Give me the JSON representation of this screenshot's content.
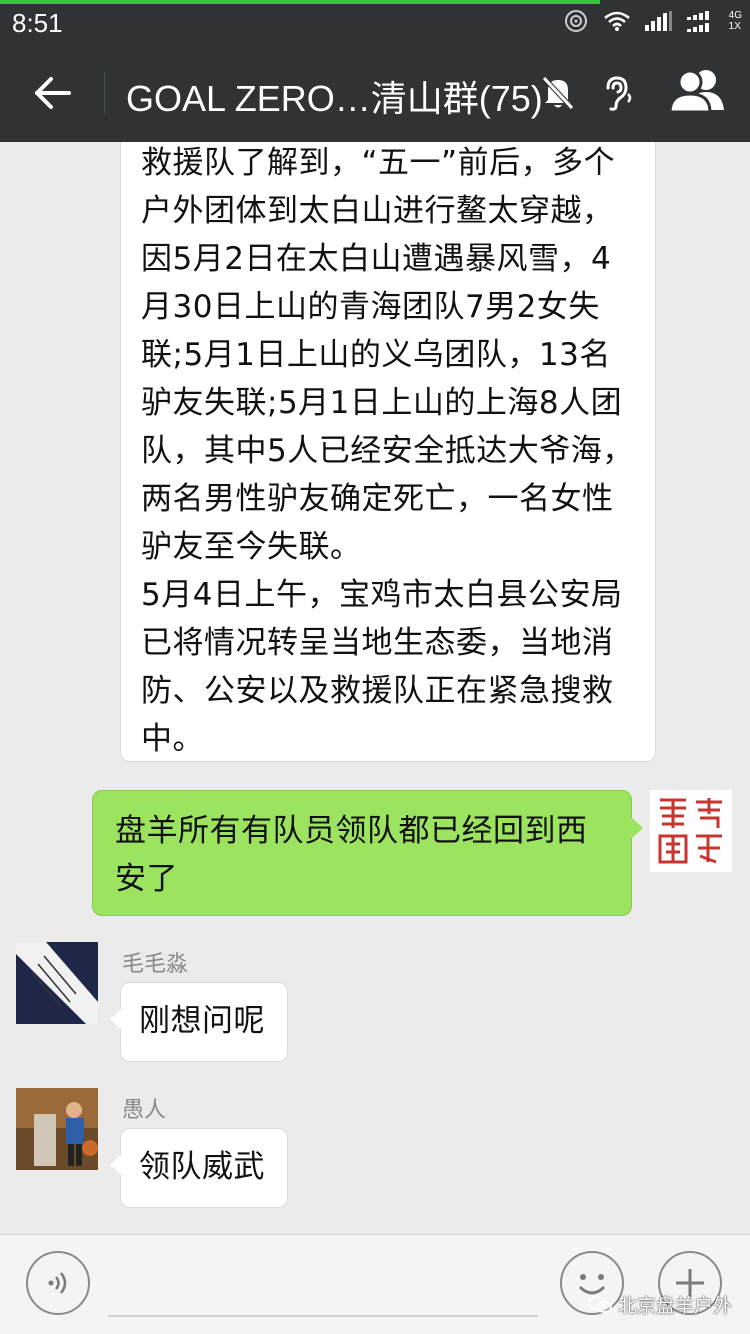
{
  "status_bar": {
    "time": "8:51",
    "network_top": "4G",
    "network_bottom": "1X"
  },
  "header": {
    "title": "GOAL ZERO…清山群(75)",
    "icons": [
      "back-arrow-icon",
      "mute-bell-icon",
      "earpiece-icon",
      "group-members-icon"
    ]
  },
  "messages": [
    {
      "side": "left",
      "lines": [
        "救援队了解到，“五一”前后，多个",
        "户外团体到太白山进行鳌太穿越，",
        "因5月2日在太白山遭遇暴风雪，4",
        "月30日上山的青海团队7男2女失",
        "联;5月1日上山的义乌团队，13名",
        "驴友失联;5月1日上山的上海8人团",
        "队，其中5人已经安全抵达大爷海，",
        "两名男性驴友确定死亡，一名女性",
        "驴友至今失联。",
        "5月4日上午，宝鸡市太白县公安局",
        "已将情况转呈当地生态委，当地消",
        "防、公安以及救援队正在紧急搜救",
        "中。"
      ]
    },
    {
      "side": "right",
      "text": "盘羊所有有队员领队都已经回到西安了"
    },
    {
      "side": "left",
      "sender": "毛毛淼",
      "text": "刚想问呢"
    },
    {
      "side": "left",
      "sender": "愚人",
      "text": "领队威武"
    }
  ],
  "input_bar": {
    "watermark": "北京盘羊户外"
  },
  "colors": {
    "header_bg": "#2f3336",
    "chat_bg": "#ebebeb",
    "self_bubble": "#9ce45f",
    "other_bubble": "#ffffff"
  }
}
